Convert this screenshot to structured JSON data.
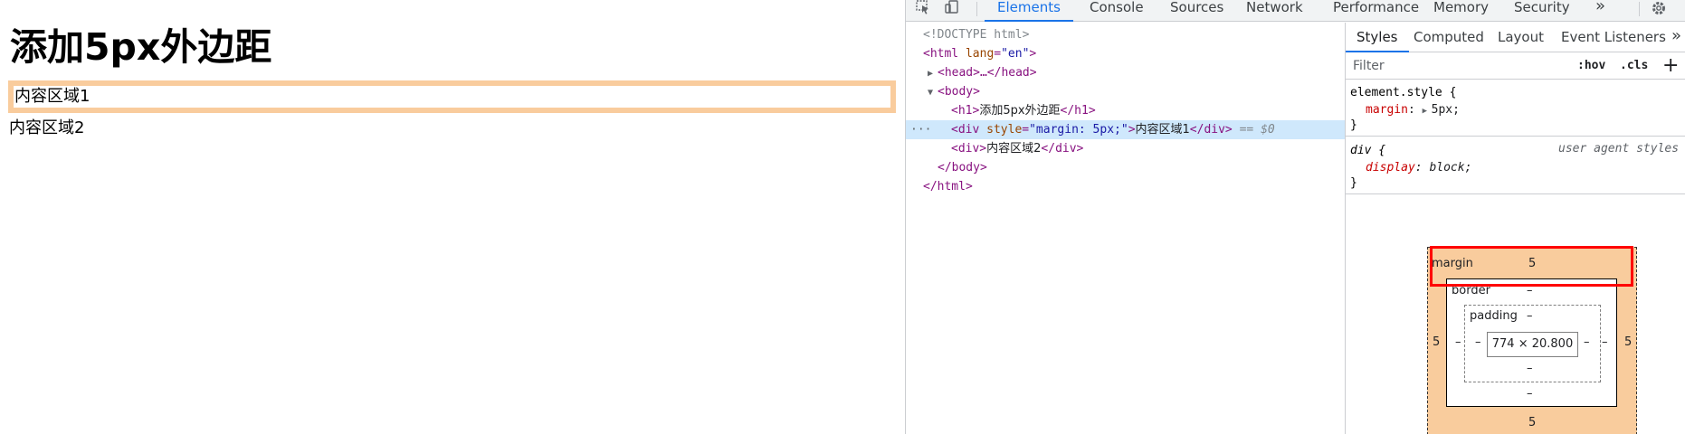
{
  "page": {
    "heading": "添加5px外边距",
    "div1_text": "内容区域1",
    "div2_text": "内容区域2"
  },
  "devtools": {
    "tabs": [
      "Elements",
      "Console",
      "Sources",
      "Network",
      "Performance",
      "Memory",
      "Security"
    ],
    "active_tab": "Elements",
    "more_tabs": "»",
    "dom": {
      "doctype": "<!DOCTYPE html>",
      "html_open_tag": "html",
      "html_attr": "lang",
      "html_attr_value": "\"en\"",
      "head": "<head>…</head>",
      "body_open": "<body>",
      "h1_text": "添加5px外边距",
      "div1_attr": "style",
      "div1_attr_value": "\"margin: 5px;\"",
      "div1_text": "内容区域1",
      "selected_marker": "== $0",
      "div2_text": "内容区域2",
      "body_close": "</body>",
      "html_close": "</html>",
      "ellipsis": "···"
    },
    "styles": {
      "sub_tabs": [
        "Styles",
        "Computed",
        "Layout",
        "Event Listeners"
      ],
      "active_sub_tab": "Styles",
      "more": "»",
      "filter_placeholder": "Filter",
      "hov": ":hov",
      "cls": ".cls",
      "plus": "+",
      "element_style_selector": "element.style {",
      "element_style_prop": "margin",
      "element_style_value": "5px;",
      "ua_selector": "div {",
      "ua_label": "user agent styles",
      "ua_prop": "display",
      "ua_value": "block;",
      "close_brace": "}"
    },
    "box_model": {
      "margin_label": "margin",
      "margin_top": "5",
      "margin_right": "5",
      "margin_bottom": "5",
      "margin_left": "5",
      "border_label": "border",
      "border_value": "–",
      "padding_label": "padding",
      "padding_value": "–",
      "content": "774 × 20.800"
    },
    "colors": {
      "accent": "#1a73e8",
      "margin_fill": "#f9cc9d",
      "highlight": "#ff0000",
      "selected_row": "#cfe8fc"
    }
  }
}
